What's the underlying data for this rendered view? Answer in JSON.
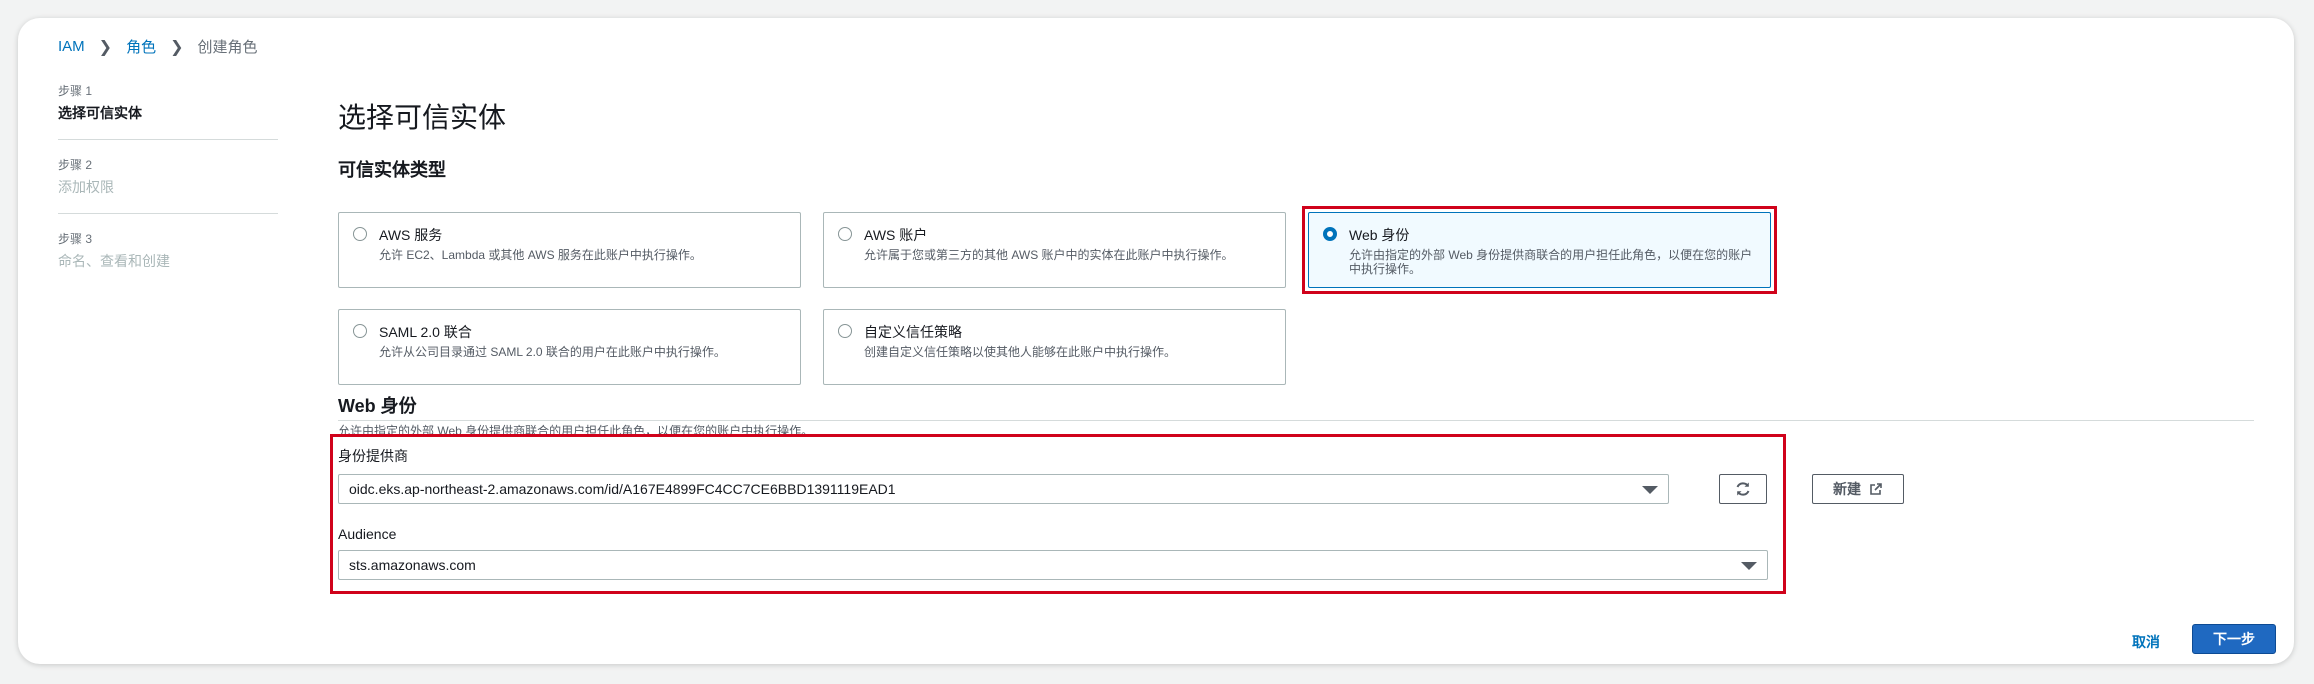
{
  "breadcrumb": {
    "items": [
      "IAM",
      "角色",
      "创建角色"
    ]
  },
  "steps": [
    {
      "num": "步骤 1",
      "title": "选择可信实体",
      "state": "active"
    },
    {
      "num": "步骤 2",
      "title": "添加权限",
      "state": "inactive"
    },
    {
      "num": "步骤 3",
      "title": "命名、查看和创建",
      "state": "inactive"
    }
  ],
  "page": {
    "title": "选择可信实体",
    "section_title": "可信实体类型"
  },
  "entity_types": [
    {
      "title": "AWS 服务",
      "desc": "允许 EC2、Lambda 或其他 AWS 服务在此账户中执行操作。",
      "selected": false
    },
    {
      "title": "AWS 账户",
      "desc": "允许属于您或第三方的其他 AWS 账户中的实体在此账户中执行操作。",
      "selected": false
    },
    {
      "title": "Web 身份",
      "desc": "允许由指定的外部 Web 身份提供商联合的用户担任此角色，以便在您的账户中执行操作。",
      "selected": true
    },
    {
      "title": "SAML 2.0 联合",
      "desc": "允许从公司目录通过 SAML 2.0 联合的用户在此账户中执行操作。",
      "selected": false
    },
    {
      "title": "自定义信任策略",
      "desc": "创建自定义信任策略以使其他人能够在此账户中执行操作。",
      "selected": false
    }
  ],
  "web_identity": {
    "title": "Web 身份",
    "desc": "允许由指定的外部 Web 身份提供商联合的用户担任此角色，以便在您的账户中执行操作。",
    "provider_label": "身份提供商",
    "provider_value": "oidc.eks.ap-northeast-2.amazonaws.com/id/A167E4899FC4CC7CE6BBD1391119EAD1",
    "audience_label": "Audience",
    "audience_value": "sts.amazonaws.com",
    "new_label": "新建"
  },
  "footer": {
    "cancel_label": "取消",
    "next_label": "下一步"
  },
  "colors": {
    "link": "#0073bb",
    "primary": "#1f69c1",
    "highlight": "#d0021b",
    "selected_bg": "#f1faff"
  }
}
